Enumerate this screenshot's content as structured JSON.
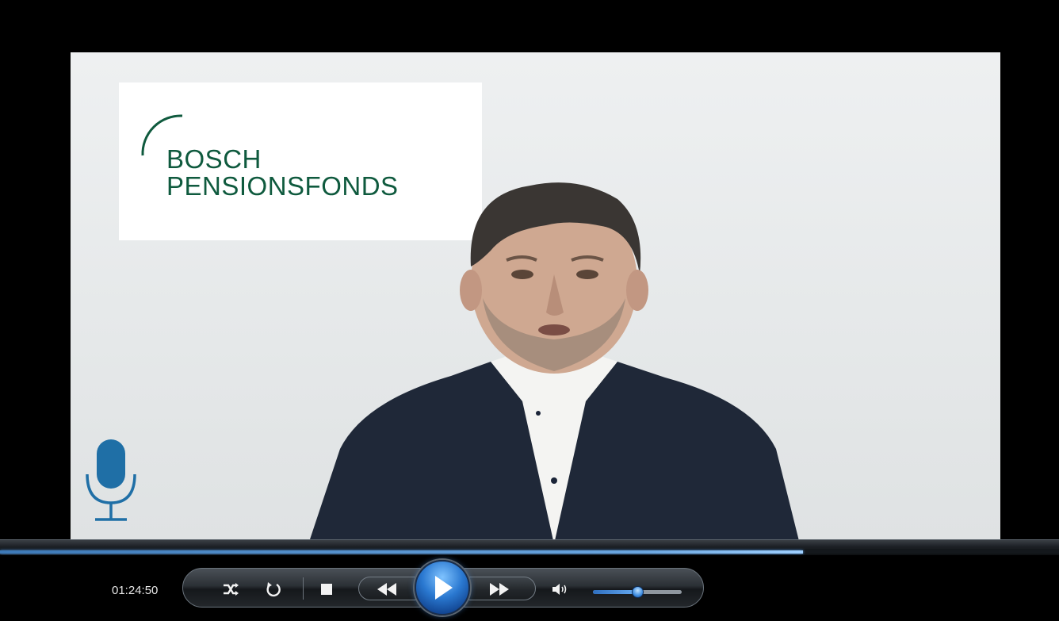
{
  "video": {
    "logo_line1": "BOSCH",
    "logo_line2": "PENSIONSFONDS",
    "brand_color": "#0f5a3e",
    "mic_color": "#1f6fa6"
  },
  "playback": {
    "elapsed_time": "01:24:50",
    "progress_fraction": 0.758,
    "volume_fraction": 0.5,
    "accent_color": "#3d79b7"
  },
  "controls": {
    "shuffle_icon": "shuffle-icon",
    "repeat_icon": "repeat-icon",
    "stop_icon": "stop-icon",
    "rewind_icon": "rewind-icon",
    "play_icon": "play-icon",
    "fast_forward_icon": "fast-forward-icon",
    "volume_icon": "speaker-icon"
  }
}
